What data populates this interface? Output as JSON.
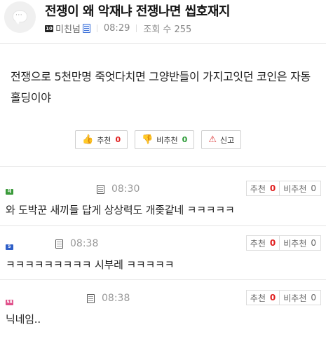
{
  "post": {
    "title": "전쟁이 왜 악재냐 전쟁나면 씹호재지",
    "level_badge": "10",
    "author": "미친넘",
    "time": "08:29",
    "views": "조회 수 255",
    "body": "전쟁으로 5천만명 죽엇다치면 그양반들이 가지고잇던 코인은 자동홀딩이야"
  },
  "vote": {
    "up_label": "추천",
    "up_count": "0",
    "down_label": "비추천",
    "down_count": "0",
    "report_label": "신고"
  },
  "comments": [
    {
      "badge": "레",
      "badge_color": "#3a9a3a",
      "time": "08:30",
      "up_label": "추천",
      "up_count": "0",
      "down_label": "비추천",
      "down_count": "0",
      "text": "와 도박꾼 새끼들 답게 상상력도 개좆같네 ㅋㅋㅋㅋㅋ"
    },
    {
      "badge": "5",
      "badge_color": "#2f5fc8",
      "time": "08:38",
      "up_label": "추천",
      "up_count": "0",
      "down_label": "비추천",
      "down_count": "0",
      "text": "ㅋㅋㅋㅋㅋㅋㅋㅋㅋ 시부레 ㅋㅋㅋㅋㅋ"
    },
    {
      "badge": "58",
      "badge_color": "#e0508a",
      "time": "08:38",
      "up_label": "추천",
      "up_count": "0",
      "down_label": "비추천",
      "down_count": "0",
      "text": "닉네임.."
    }
  ]
}
